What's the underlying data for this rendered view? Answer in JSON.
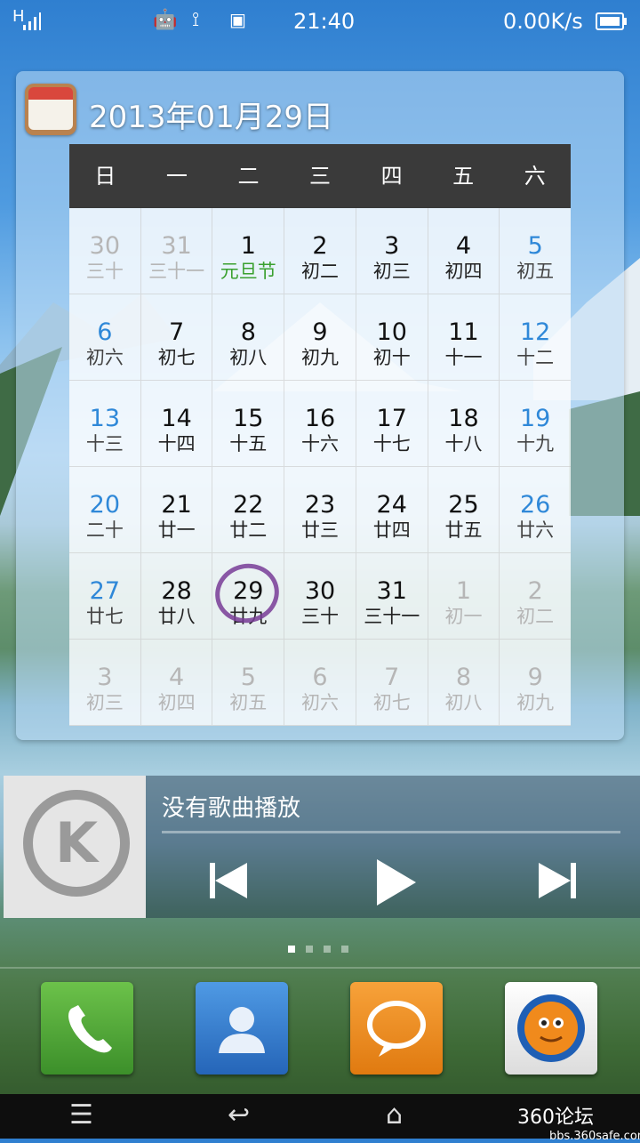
{
  "status_bar": {
    "signal": "H",
    "time": "21:40",
    "net_speed": "0.00K/s"
  },
  "calendar_widget": {
    "date_title": "2013年01月29日",
    "weekdays": [
      "日",
      "一",
      "二",
      "三",
      "四",
      "五",
      "六"
    ],
    "rows": [
      [
        {
          "d": "30",
          "l": "三十",
          "dim": true
        },
        {
          "d": "31",
          "l": "三十一",
          "dim": true
        },
        {
          "d": "1",
          "l": "元旦节",
          "holiday": true
        },
        {
          "d": "2",
          "l": "初二"
        },
        {
          "d": "3",
          "l": "初三"
        },
        {
          "d": "4",
          "l": "初四"
        },
        {
          "d": "5",
          "l": "初五"
        }
      ],
      [
        {
          "d": "6",
          "l": "初六"
        },
        {
          "d": "7",
          "l": "初七"
        },
        {
          "d": "8",
          "l": "初八"
        },
        {
          "d": "9",
          "l": "初九"
        },
        {
          "d": "10",
          "l": "初十"
        },
        {
          "d": "11",
          "l": "十一"
        },
        {
          "d": "12",
          "l": "十二"
        }
      ],
      [
        {
          "d": "13",
          "l": "十三"
        },
        {
          "d": "14",
          "l": "十四"
        },
        {
          "d": "15",
          "l": "十五"
        },
        {
          "d": "16",
          "l": "十六"
        },
        {
          "d": "17",
          "l": "十七"
        },
        {
          "d": "18",
          "l": "十八"
        },
        {
          "d": "19",
          "l": "十九"
        }
      ],
      [
        {
          "d": "20",
          "l": "二十"
        },
        {
          "d": "21",
          "l": "廿一"
        },
        {
          "d": "22",
          "l": "廿二"
        },
        {
          "d": "23",
          "l": "廿三"
        },
        {
          "d": "24",
          "l": "廿四"
        },
        {
          "d": "25",
          "l": "廿五"
        },
        {
          "d": "26",
          "l": "廿六"
        }
      ],
      [
        {
          "d": "27",
          "l": "廿七"
        },
        {
          "d": "28",
          "l": "廿八"
        },
        {
          "d": "29",
          "l": "廿九",
          "today": true
        },
        {
          "d": "30",
          "l": "三十"
        },
        {
          "d": "31",
          "l": "三十一"
        },
        {
          "d": "1",
          "l": "初一",
          "dim": true
        },
        {
          "d": "2",
          "l": "初二",
          "dim": true
        }
      ],
      [
        {
          "d": "3",
          "l": "初三",
          "dim": true
        },
        {
          "d": "4",
          "l": "初四",
          "dim": true
        },
        {
          "d": "5",
          "l": "初五",
          "dim": true
        },
        {
          "d": "6",
          "l": "初六",
          "dim": true
        },
        {
          "d": "7",
          "l": "初七",
          "dim": true
        },
        {
          "d": "8",
          "l": "初八",
          "dim": true
        },
        {
          "d": "9",
          "l": "初九",
          "dim": true
        }
      ]
    ]
  },
  "music_widget": {
    "album_letter": "K",
    "song_title": "没有歌曲播放"
  },
  "page_indicator": {
    "count": 4,
    "active": 0
  },
  "dock": [
    {
      "name": "phone",
      "color": "#49a335"
    },
    {
      "name": "contacts",
      "color": "#2f7fcf"
    },
    {
      "name": "messages",
      "color": "#e88a1a"
    },
    {
      "name": "uc-browser",
      "color": "#f2f2f2"
    }
  ],
  "watermark": {
    "line1": "360论坛",
    "line2": "bbs.360safe.com"
  }
}
